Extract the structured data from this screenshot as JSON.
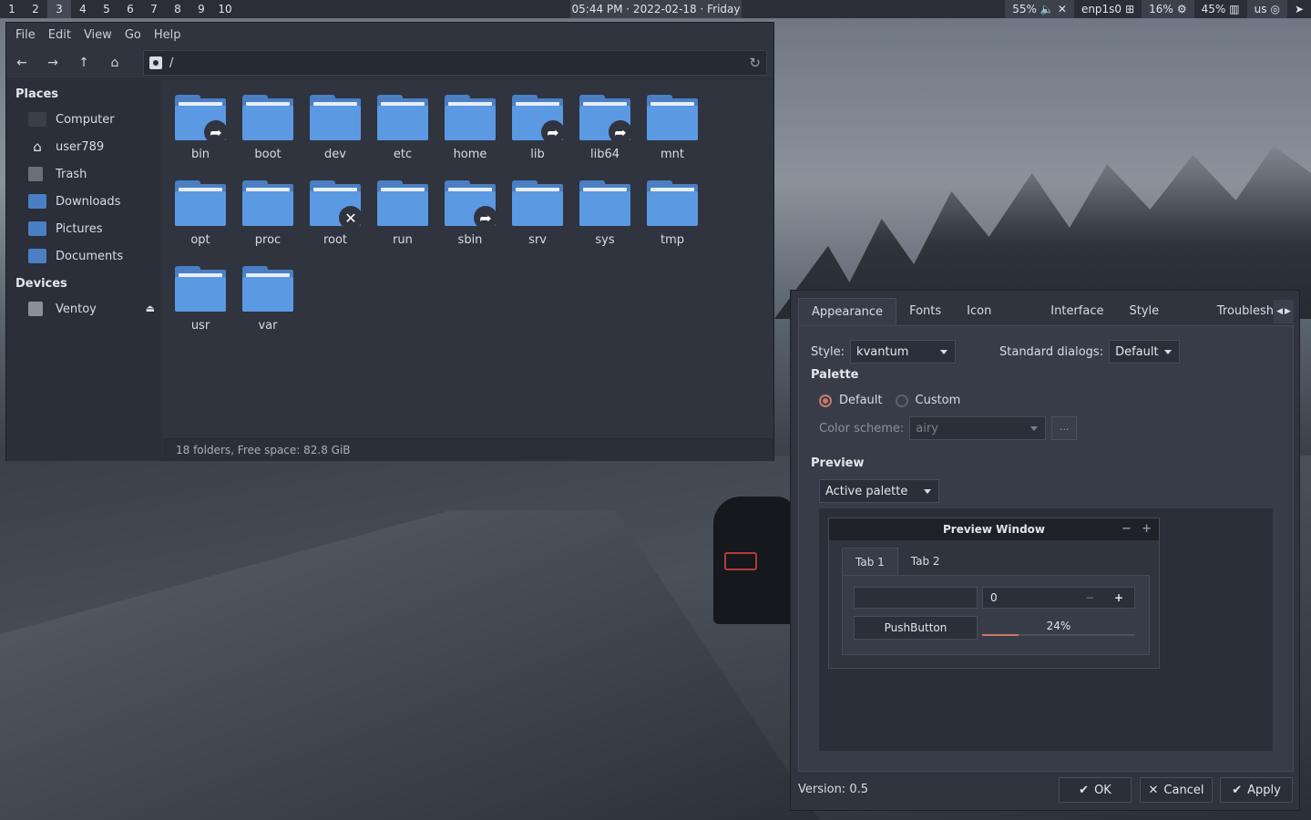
{
  "topbar": {
    "workspaces": [
      "1",
      "2",
      "3",
      "4",
      "5",
      "6",
      "7",
      "8",
      "9",
      "10"
    ],
    "active_workspace": "3",
    "clock": "05:44 PM · 2022-02-18 · Friday",
    "volume": "55%",
    "network": "enp1s0",
    "cpu": "16%",
    "memory": "45%",
    "keyboard": "us"
  },
  "filemanager": {
    "menu": [
      "File",
      "Edit",
      "View",
      "Go",
      "Help"
    ],
    "path": "/",
    "places_header": "Places",
    "places": [
      {
        "label": "Computer",
        "icon": "computer-icon",
        "color": "#3a3f49"
      },
      {
        "label": "user789",
        "icon": "home-icon",
        "color": "#2b2f39"
      },
      {
        "label": "Trash",
        "icon": "trash-icon",
        "color": "#6a6f78"
      },
      {
        "label": "Downloads",
        "icon": "downloads-folder-icon",
        "color": "#4a7fc4"
      },
      {
        "label": "Pictures",
        "icon": "pictures-folder-icon",
        "color": "#4a7fc4"
      },
      {
        "label": "Documents",
        "icon": "documents-folder-icon",
        "color": "#4a7fc4"
      }
    ],
    "devices_header": "Devices",
    "devices": [
      {
        "label": "Ventoy",
        "icon": "drive-icon"
      }
    ],
    "folders": [
      {
        "name": "bin",
        "badge": "link"
      },
      {
        "name": "boot",
        "badge": ""
      },
      {
        "name": "dev",
        "badge": ""
      },
      {
        "name": "etc",
        "badge": ""
      },
      {
        "name": "home",
        "badge": ""
      },
      {
        "name": "lib",
        "badge": "link"
      },
      {
        "name": "lib64",
        "badge": "link"
      },
      {
        "name": "mnt",
        "badge": ""
      },
      {
        "name": "opt",
        "badge": ""
      },
      {
        "name": "proc",
        "badge": ""
      },
      {
        "name": "root",
        "badge": "locked"
      },
      {
        "name": "run",
        "badge": ""
      },
      {
        "name": "sbin",
        "badge": "link"
      },
      {
        "name": "srv",
        "badge": ""
      },
      {
        "name": "sys",
        "badge": ""
      },
      {
        "name": "tmp",
        "badge": ""
      },
      {
        "name": "usr",
        "badge": ""
      },
      {
        "name": "var",
        "badge": ""
      }
    ],
    "status": "18 folders, Free space: 82.8 GiB"
  },
  "dialog": {
    "tabs": [
      "Appearance",
      "Fonts",
      "Icon Theme",
      "Interface",
      "Style Sheets",
      "Troublesho"
    ],
    "active_tab": "Appearance",
    "style_label": "Style:",
    "style_value": "kvantum",
    "std_dialogs_label": "Standard dialogs:",
    "std_dialogs_value": "Default",
    "palette_header": "Palette",
    "palette_default": "Default",
    "palette_custom": "Custom",
    "color_scheme_label": "Color scheme:",
    "color_scheme_value": "airy",
    "color_scheme_more": "...",
    "preview_header": "Preview",
    "preview_combo": "Active palette",
    "preview_window": {
      "title": "Preview Window",
      "tabs": [
        "Tab 1",
        "Tab 2"
      ],
      "spin_value": "0",
      "pushbutton": "PushButton",
      "progress_label": "24%",
      "progress": 0.24
    },
    "version": "Version: 0.5",
    "ok": "OK",
    "cancel": "Cancel",
    "apply": "Apply"
  }
}
